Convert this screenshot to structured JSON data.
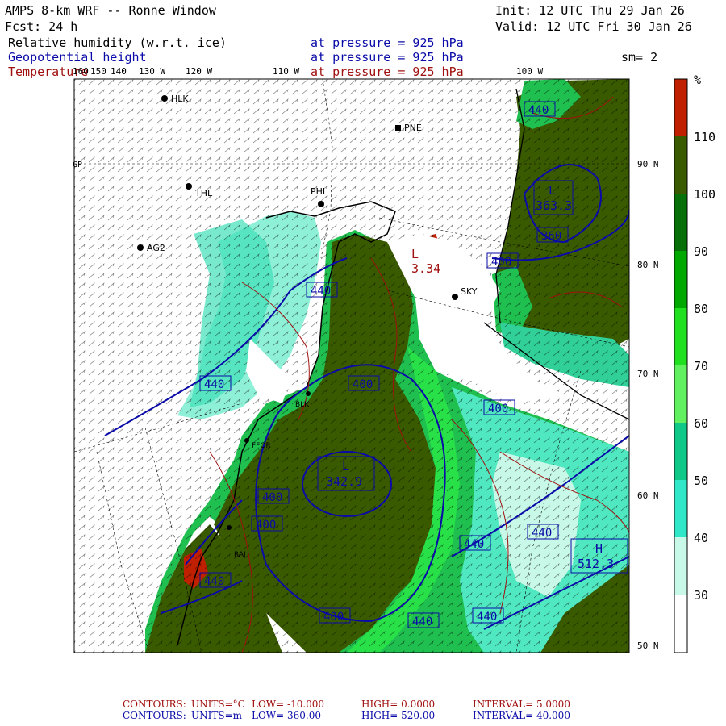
{
  "header": {
    "title": "AMPS 8-km WRF -- Ronne Window",
    "init": "Init: 12 UTC Thu 29 Jan 26",
    "fcst": "Fcst:   24 h",
    "valid": "Valid: 12 UTC Fri 30 Jan 26",
    "field1_name": "Relative humidity (w.r.t. ice)",
    "field1_level": "at pressure =  925 hPa",
    "field2_name": "Geopotential height",
    "field2_level": "at pressure =  925 hPa",
    "field3_name": "Temperature",
    "field3_level": "at pressure =  925 hPa",
    "smoothing": "sm= 2"
  },
  "map": {
    "top_lon_labels": [
      "160",
      "150",
      "140",
      "130 W",
      "120 W",
      "110 W",
      "100 W"
    ],
    "right_lat_labels": [
      "90 N",
      "80 N",
      "70 N",
      "60 N",
      "50 N"
    ],
    "left_axis_label": "GP",
    "stations": [
      {
        "id": "HLK"
      },
      {
        "id": "PNE"
      },
      {
        "id": "THL"
      },
      {
        "id": "PHL"
      },
      {
        "id": "AG2"
      },
      {
        "id": "SKY"
      },
      {
        "id": "BLK"
      },
      {
        "id": "FFOR"
      },
      {
        "id": "RAI"
      }
    ],
    "height_boxes": [
      "440",
      "440",
      "400",
      "400",
      "400",
      "440",
      "440",
      "400",
      "440",
      "440",
      "440",
      "360",
      "440",
      "400",
      "400"
    ],
    "extrema": [
      {
        "type": "L",
        "value": "342.9"
      },
      {
        "type": "H",
        "value": "512.3"
      },
      {
        "type": "L",
        "value": "363.3"
      },
      {
        "type": "L",
        "value": "3.34"
      }
    ]
  },
  "colorbar": {
    "unit": "%",
    "tick_labels": [
      "110",
      "100",
      "90",
      "80",
      "70",
      "60",
      "50",
      "40",
      "30"
    ],
    "colors": [
      "#c02000",
      "#3a5a00",
      "#087008",
      "#00a800",
      "#20e020",
      "#60f060",
      "#10c888",
      "#30e8c8",
      "#c8f8e8",
      "#ffffff"
    ]
  },
  "footer": {
    "line1": {
      "label": "CONTOURS:",
      "units": "UNITS=°C",
      "low": "LOW= -10.000",
      "high": "HIGH=  0.0000",
      "interval": "INTERVAL=   5.0000"
    },
    "line2": {
      "label": "CONTOURS:",
      "units": "UNITS=m",
      "low": "LOW=  360.00",
      "high": "HIGH=  520.00",
      "interval": "INTERVAL=  40.000"
    }
  },
  "colors": {
    "height_contour": "#0a0aa8",
    "temp_contour": "#a01010",
    "background": "#ffffff"
  }
}
